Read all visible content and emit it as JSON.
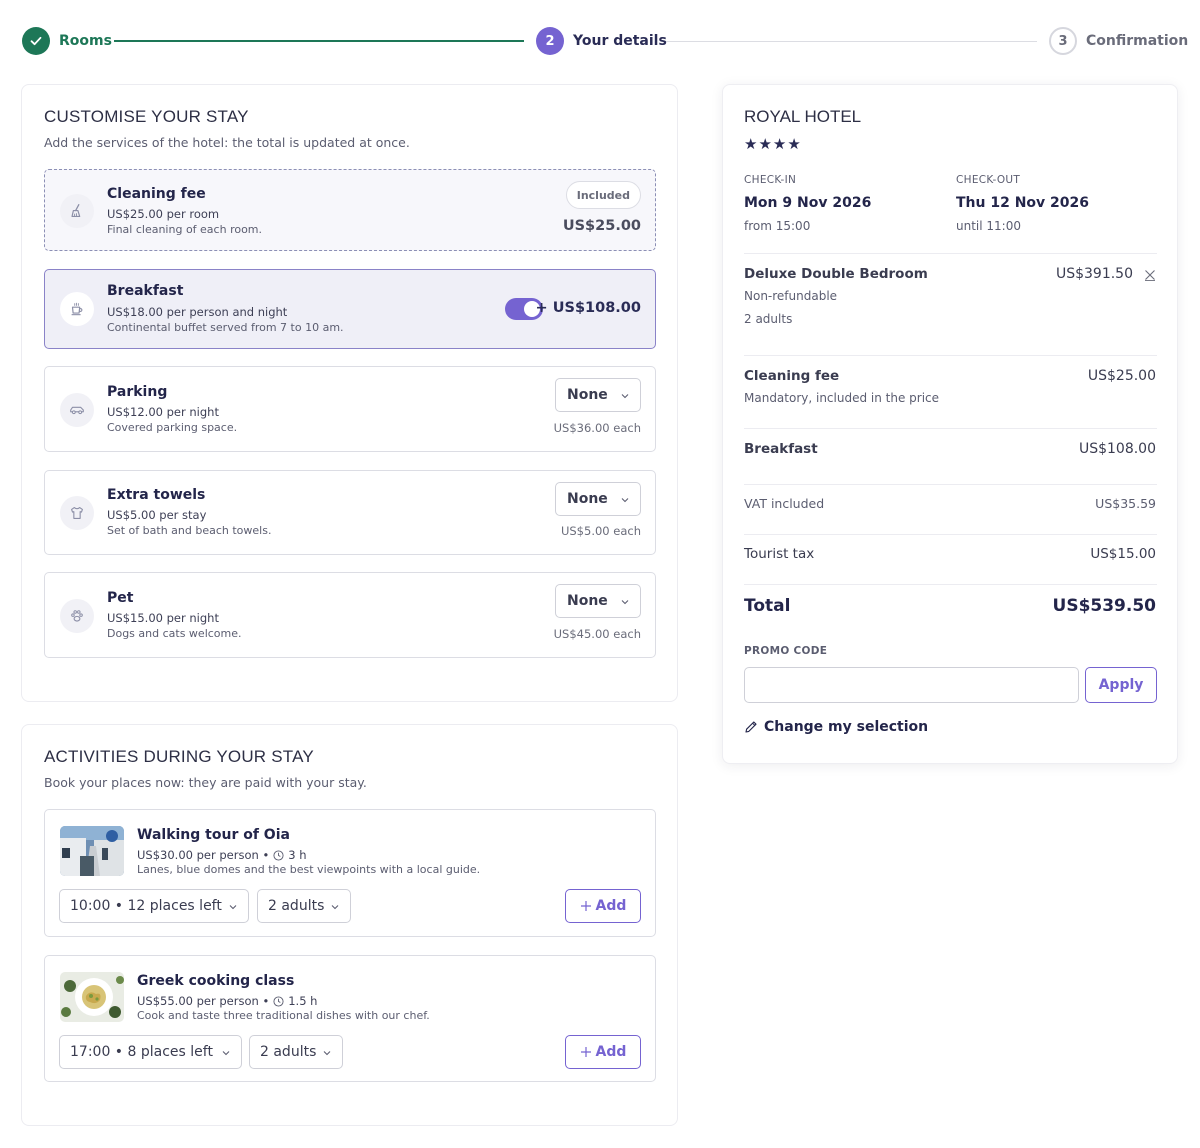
{
  "stepper": {
    "steps": [
      {
        "label": "Rooms",
        "state": "done"
      },
      {
        "label": "Your details",
        "number": "2",
        "state": "current"
      },
      {
        "label": "Confirmation",
        "number": "3",
        "state": "todo"
      }
    ]
  },
  "customise": {
    "title": "CUSTOMISE YOUR STAY",
    "subtitle": "Add the services of the hotel: the total is updated at once.",
    "services": [
      {
        "name": "Cleaning fee",
        "price": "US$25.00 per room",
        "desc": "Final cleaning of each room.",
        "badge": "Included",
        "amount": "US$25.00",
        "icon": "broom-icon"
      },
      {
        "name": "Breakfast",
        "price": "US$18.00 per person and night",
        "desc": "Continental buffet served from 7 to 10 am.",
        "amount": "+ US$108.00",
        "toggle_on": true,
        "icon": "coffee-cup-icon"
      },
      {
        "name": "Parking",
        "price": "US$12.00 per night",
        "desc": "Covered parking space.",
        "select_value": "None",
        "each": "US$36.00 each",
        "icon": "car-icon"
      },
      {
        "name": "Extra towels",
        "price": "US$5.00 per stay",
        "desc": "Set of bath and beach towels.",
        "select_value": "None",
        "each": "US$5.00 each",
        "icon": "shirt-icon"
      },
      {
        "name": "Pet",
        "price": "US$15.00 per night",
        "desc": "Dogs and cats welcome.",
        "select_value": "None",
        "each": "US$45.00 each",
        "icon": "paw-icon"
      }
    ]
  },
  "activities": {
    "title": "ACTIVITIES DURING YOUR STAY",
    "subtitle": "Book your places now: they are paid with your stay.",
    "items": [
      {
        "name": "Walking tour of Oia",
        "price": "US$30.00 per person •",
        "duration": "3 h",
        "desc": "Lanes, blue domes and the best viewpoints with a local guide.",
        "slot": "10:00 • 12 places left",
        "guests": "2 adults",
        "add_label": "Add"
      },
      {
        "name": "Greek cooking class",
        "price": "US$55.00 per person •",
        "duration": "1.5 h",
        "desc": "Cook and taste three traditional dishes with our chef.",
        "slot": "17:00 • 8 places left",
        "guests": "2 adults",
        "add_label": "Add"
      }
    ]
  },
  "summary": {
    "hotel_name": "ROYAL HOTEL",
    "stars": 4,
    "checkin": {
      "label": "CHECK-IN",
      "date": "Mon 9 Nov 2026",
      "time": "from 15:00"
    },
    "checkout": {
      "label": "CHECK-OUT",
      "date": "Thu 12 Nov 2026",
      "time": "until 11:00"
    },
    "room": {
      "name": "Deluxe Double Bedroom",
      "policy": "Non-refundable",
      "guests": "2 adults",
      "amount": "US$391.50"
    },
    "cleaning": {
      "name": "Cleaning fee",
      "note": "Mandatory, included in the price",
      "amount": "US$25.00"
    },
    "breakfast": {
      "name": "Breakfast",
      "amount": "US$108.00"
    },
    "vat": {
      "label": "VAT included",
      "amount": "US$35.59"
    },
    "tourist_tax": {
      "label": "Tourist tax",
      "amount": "US$15.00"
    },
    "total": {
      "label": "Total",
      "amount": "US$539.50"
    },
    "promo": {
      "label": "PROMO CODE",
      "placeholder": "",
      "apply_label": "Apply"
    },
    "change_label": "Change my selection"
  },
  "colors": {
    "accent": "#7563d1",
    "success": "#1d7757",
    "navy": "#23254a"
  }
}
